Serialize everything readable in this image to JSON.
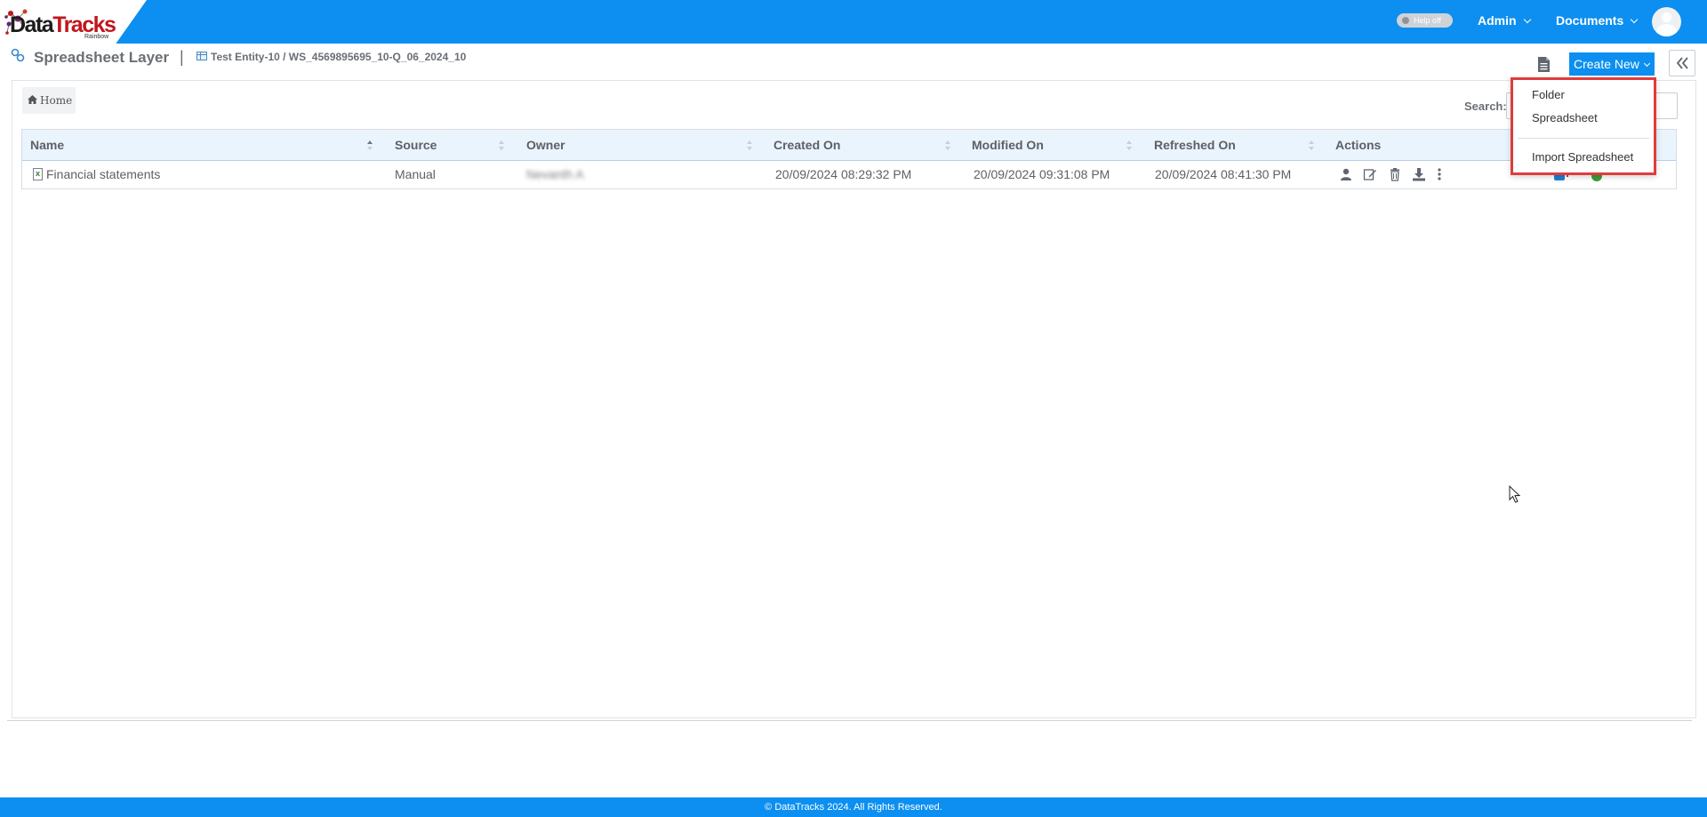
{
  "brand": {
    "logo_main": "Data",
    "logo_accent": "Tracks",
    "logo_sub": "Rainbow",
    "primary_color": "#0c8ff0",
    "highlight_color": "#e03c3c"
  },
  "topbar": {
    "help_toggle": "Help off",
    "menus": [
      "Admin",
      "Documents"
    ]
  },
  "header": {
    "title": "Spreadsheet Layer",
    "separator": "|",
    "path": "Test Entity-10 / WS_4569895695_10-Q_06_2024_10",
    "create_new_label": "Create New"
  },
  "breadcrumb": {
    "home": "Home"
  },
  "search": {
    "label": "Search:",
    "value": ""
  },
  "table": {
    "columns": [
      "Name",
      "Source",
      "Owner",
      "Created On",
      "Modified On",
      "Refreshed On",
      "Actions"
    ],
    "rows": [
      {
        "name": "Financial statements",
        "source": "Manual",
        "owner": "Nevanth A",
        "created_on": "20/09/2024 08:29:32 PM",
        "modified_on": "20/09/2024 09:31:08 PM",
        "refreshed_on": "20/09/2024 08:41:30 PM",
        "actions": [
          "user-icon",
          "edit-icon",
          "trash-icon",
          "download-icon",
          "more-vertical-icon"
        ]
      }
    ]
  },
  "create_menu": {
    "items": [
      "Folder",
      "Spreadsheet",
      "Import Spreadsheet"
    ]
  },
  "footer": {
    "copyright": "© DataTracks 2024. All Rights Reserved."
  }
}
